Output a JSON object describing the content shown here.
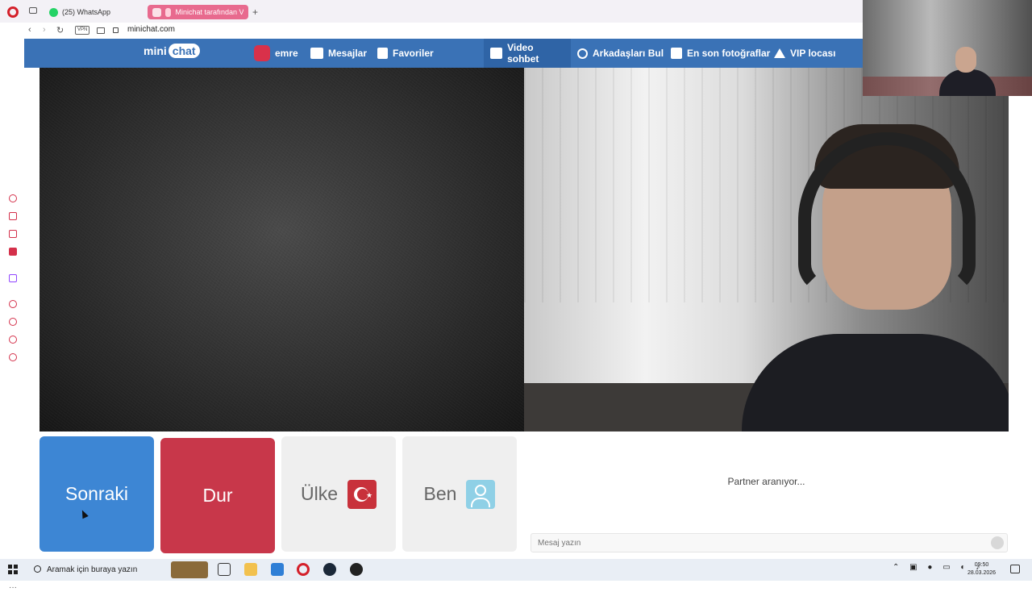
{
  "browser": {
    "tabs": [
      {
        "label": "(25) WhatsApp",
        "active": false,
        "icon": "whatsapp-icon"
      },
      {
        "label": "Minichat tarafından Vi",
        "active": true,
        "icon": "speaker-icon"
      }
    ],
    "vpn_label": "VPN",
    "url": "minichat.com"
  },
  "site": {
    "logo": {
      "mini": "mini",
      "chat": "chat"
    },
    "nav": [
      {
        "label": "emre",
        "icon": "gamepad-icon"
      },
      {
        "label": "Mesajlar",
        "icon": "envelope-icon"
      },
      {
        "label": "Favoriler",
        "icon": "bookmark-icon"
      },
      {
        "label": "Video sohbet",
        "icon": "video-chat-icon",
        "active": true
      },
      {
        "label": "Arkadaşları Bul",
        "icon": "search-icon"
      },
      {
        "label": "En son fotoğraflar",
        "icon": "photos-icon"
      },
      {
        "label": "VIP locası",
        "icon": "crown-icon"
      }
    ],
    "brand_color": "#3a72b6"
  },
  "controls": {
    "next": "Sonraki",
    "stop": "Dur",
    "country": "Ülke",
    "me": "Ben",
    "next_color": "#3d86d4",
    "stop_color": "#c8374a"
  },
  "chat": {
    "status": "Partner aranıyor...",
    "input_placeholder": "Mesaj yazın"
  },
  "taskbar": {
    "search_placeholder": "Aramak için buraya yazın",
    "time": "09:50",
    "date": "28.03.2026"
  }
}
